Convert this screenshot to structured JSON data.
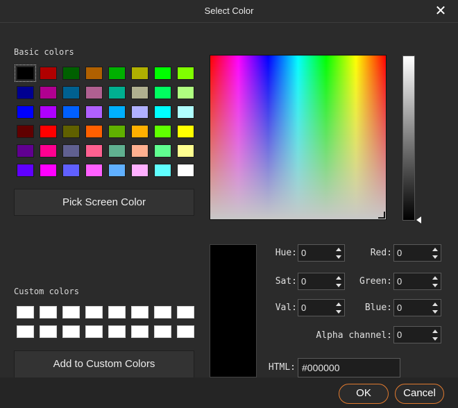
{
  "window": {
    "title": "Select Color",
    "close_glyph": "✕",
    "close_icon": "close-icon"
  },
  "basic_colors": {
    "label": "Basic colors",
    "selected_index": 0,
    "swatches": [
      "#000000",
      "#b00000",
      "#006000",
      "#b06000",
      "#00b000",
      "#b0b000",
      "#00ff00",
      "#80ff00",
      "#000090",
      "#b00090",
      "#006090",
      "#b06090",
      "#00b090",
      "#b0b090",
      "#00ff60",
      "#b0ff80",
      "#0000ff",
      "#b000ff",
      "#0060ff",
      "#b060ff",
      "#00b0ff",
      "#b0b0ff",
      "#00ffff",
      "#b0ffff",
      "#600000",
      "#ff0000",
      "#606000",
      "#ff6000",
      "#60b000",
      "#ffb000",
      "#60ff00",
      "#ffff00",
      "#600090",
      "#ff0090",
      "#606090",
      "#ff6090",
      "#60b090",
      "#ffb090",
      "#60ff90",
      "#ffff90",
      "#6000ff",
      "#ff00ff",
      "#6060ff",
      "#ff60ff",
      "#60b0ff",
      "#ffb0ff",
      "#60ffff",
      "#ffffff"
    ]
  },
  "pick_screen_color": {
    "label": "Pick Screen Color"
  },
  "custom_colors": {
    "label": "Custom colors",
    "swatches": [
      "#ffffff",
      "#ffffff",
      "#ffffff",
      "#ffffff",
      "#ffffff",
      "#ffffff",
      "#ffffff",
      "#ffffff",
      "#ffffff",
      "#ffffff",
      "#ffffff",
      "#ffffff",
      "#ffffff",
      "#ffffff",
      "#ffffff",
      "#ffffff"
    ]
  },
  "add_to_custom": {
    "label": "Add to Custom Colors"
  },
  "fields": {
    "hue": {
      "label": "Hue:",
      "value": "0"
    },
    "sat": {
      "label": "Sat:",
      "value": "0"
    },
    "val": {
      "label": "Val:",
      "value": "0"
    },
    "red": {
      "label": "Red:",
      "value": "0"
    },
    "green": {
      "label": "Green:",
      "value": "0"
    },
    "blue": {
      "label": "Blue:",
      "value": "0"
    },
    "alpha": {
      "label": "Alpha channel:",
      "value": "0"
    },
    "html": {
      "label": "HTML:",
      "value": "#000000"
    }
  },
  "current_color": "#000000",
  "buttons": {
    "ok": "OK",
    "cancel": "Cancel"
  },
  "accent_color": "#e07a2f"
}
